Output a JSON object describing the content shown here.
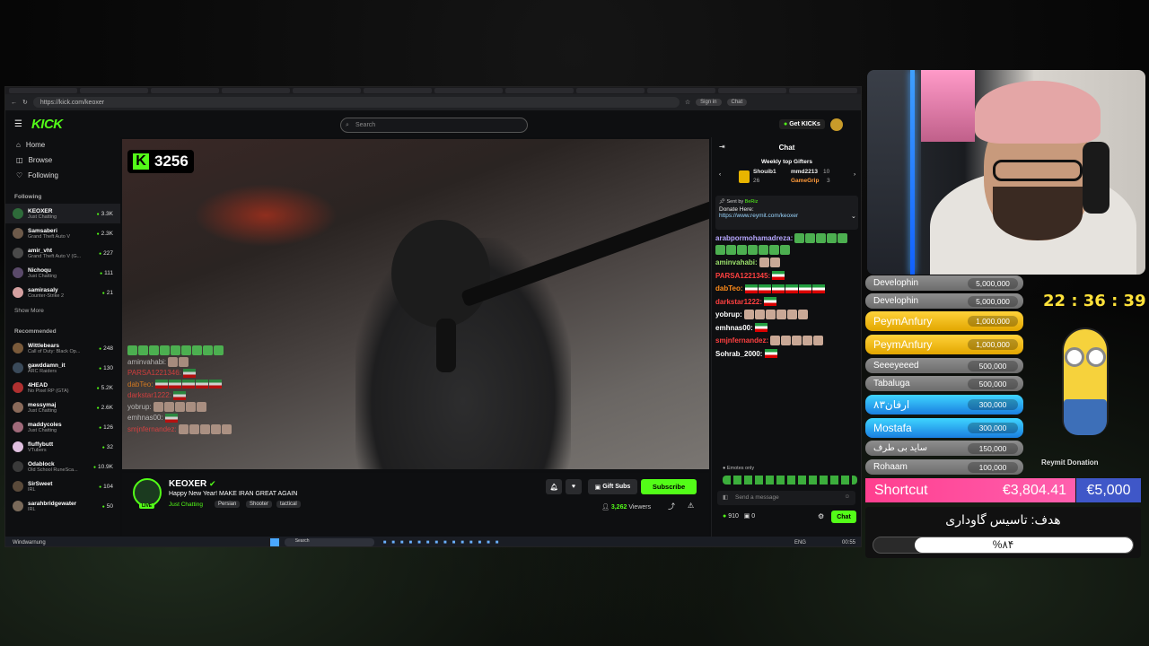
{
  "browser": {
    "url": "https://kick.com/keoxer",
    "signin_label": "Sign in",
    "chat_btn": "Chat"
  },
  "kick": {
    "logo": "KICK",
    "search_placeholder": "Search",
    "get_kicks": "Get KICKs"
  },
  "sidebar": {
    "nav": [
      {
        "label": "Home",
        "icon": "home-icon"
      },
      {
        "label": "Browse",
        "icon": "browse-icon"
      },
      {
        "label": "Following",
        "icon": "heart-icon"
      }
    ],
    "following_title": "Following",
    "following": [
      {
        "name": "KEOXER",
        "category": "Just Chatting",
        "viewers": "3.3K",
        "color": "#2e6b3a"
      },
      {
        "name": "Samsaberi",
        "category": "Grand Theft Auto V",
        "viewers": "2.3K",
        "color": "#6d5a4a"
      },
      {
        "name": "amir_vht",
        "category": "Grand Theft Auto V (G...",
        "viewers": "227",
        "color": "#4a4a4a"
      },
      {
        "name": "Nichoqu",
        "category": "Just Chatting",
        "viewers": "111",
        "color": "#5a4a6a"
      },
      {
        "name": "samirasaly",
        "category": "Counter-Strike 2",
        "viewers": "21",
        "color": "#d4a0a0"
      }
    ],
    "show_more": "Show More",
    "recommended_title": "Recommended",
    "recommended": [
      {
        "name": "Wittlebears",
        "category": "Call of Duty: Black Op...",
        "viewers": "248",
        "color": "#7a5a3a"
      },
      {
        "name": "gawddamn_it",
        "category": "ARC Raiders",
        "viewers": "130",
        "color": "#3a4a5a"
      },
      {
        "name": "4HEAD",
        "category": "No Pixel RP (GTA)",
        "viewers": "5.2K",
        "color": "#b03030"
      },
      {
        "name": "messymaj",
        "category": "Just Chatting",
        "viewers": "2.6K",
        "color": "#8a6a5a"
      },
      {
        "name": "maddycoles",
        "category": "Just Chatting",
        "viewers": "126",
        "color": "#a06a7a"
      },
      {
        "name": "fluffybutt",
        "category": "VTubers",
        "viewers": "32",
        "color": "#e0c0e0"
      },
      {
        "name": "Odablock",
        "category": "Old School RuneSca...",
        "viewers": "10.9K",
        "color": "#3a3a3a"
      },
      {
        "name": "SirSweet",
        "category": "IRL",
        "viewers": "104",
        "color": "#5a4a3a"
      },
      {
        "name": "sarahbridgewater",
        "category": "IRL",
        "viewers": "50",
        "color": "#7a6a5a"
      }
    ]
  },
  "video": {
    "k_count": "3256",
    "overlay_chat": [
      {
        "user": "aminvahabi:",
        "color": "#dddddd",
        "emotes": 2,
        "flags": 0
      },
      {
        "user": "PARSA1221346:",
        "color": "#ff4040",
        "emotes": 0,
        "flags": 1
      },
      {
        "user": "dabTeo:",
        "color": "#ff8c1a",
        "emotes": 0,
        "flags": 5
      },
      {
        "user": "darkstar1222:",
        "color": "#ff4040",
        "emotes": 0,
        "flags": 1
      },
      {
        "user": "yobrup:",
        "color": "#dddddd",
        "emotes": 5,
        "flags": 0
      },
      {
        "user": "emhnas00:",
        "color": "#dddddd",
        "emotes": 0,
        "flags": 1
      },
      {
        "user": "smjnfernandez:",
        "color": "#ff4040",
        "emotes": 5,
        "flags": 0
      }
    ]
  },
  "stream": {
    "name": "KEOXER",
    "title": "Happy New Year! MAKE IRAN GREAT AGAIN",
    "category": "Just Chatting",
    "tags": [
      "Persian",
      "Shooter",
      "tactical"
    ],
    "gift_subs": "Gift Subs",
    "subscribe": "Subscribe",
    "viewers": "3,262",
    "viewers_label": "Viewers",
    "live": "LIVE"
  },
  "chat": {
    "title": "Chat",
    "weekly_gifters": "Weekly top Gifters",
    "gifters": [
      {
        "name": "Shouib1",
        "count": "26"
      },
      {
        "name": "mmd2213",
        "count": "10"
      },
      {
        "name": "GameGrip",
        "count": "3"
      }
    ],
    "pinned_sent_by": "Sent by",
    "pinned_user": "BeRiz",
    "pinned_text": "Donate Here:",
    "pinned_link": "https://www.reymit.com/keoxer",
    "messages": [
      {
        "user": "arabpormohamadreza:",
        "color": "#b7a7ff",
        "emotes": 12,
        "flags": 0,
        "kind": "pepe"
      },
      {
        "user": "aminvahabi:",
        "color": "#9be06b",
        "emotes": 2,
        "flags": 0,
        "kind": "face"
      },
      {
        "user": "PARSA1221345:",
        "color": "#ff4040",
        "emotes": 0,
        "flags": 1,
        "kind": "flag"
      },
      {
        "user": "dabTeo:",
        "color": "#ff8c1a",
        "emotes": 0,
        "flags": 6,
        "kind": "flag"
      },
      {
        "user": "darkstar1222:",
        "color": "#ff4040",
        "emotes": 0,
        "flags": 1,
        "kind": "flag"
      },
      {
        "user": "yobrup:",
        "color": "#ffffff",
        "emotes": 6,
        "flags": 0,
        "kind": "face"
      },
      {
        "user": "emhnas00:",
        "color": "#ffffff",
        "emotes": 0,
        "flags": 1,
        "kind": "flag"
      },
      {
        "user": "smjnfernandez:",
        "color": "#ff4040",
        "emotes": 5,
        "flags": 0,
        "kind": "face"
      },
      {
        "user": "Sohrab_2000:",
        "color": "#ffffff",
        "emotes": 0,
        "flags": 1,
        "kind": "flag"
      }
    ],
    "emotes_only": "Emotes only",
    "input_placeholder": "Send a message",
    "kicks_count": "910",
    "gifts_count": "0",
    "send_label": "Chat"
  },
  "taskbar": {
    "left_label": "Windwarnung",
    "search_placeholder": "Search",
    "lang": "ENG",
    "time": "00:55"
  },
  "overlay": {
    "leaderboard": [
      {
        "name": "Develophin",
        "amount": "5,000,000",
        "style": "gray"
      },
      {
        "name": "Develophin",
        "amount": "5,000,000",
        "style": "gray"
      },
      {
        "name": "PeymAnfury",
        "amount": "1,000,000",
        "style": "gold"
      },
      {
        "name": "PeymAnfury",
        "amount": "1,000,000",
        "style": "gold"
      },
      {
        "name": "Seeeyeeed",
        "amount": "500,000",
        "style": "gray"
      },
      {
        "name": "Tabaluga",
        "amount": "500,000",
        "style": "gray"
      },
      {
        "name": "ارفان۸۳",
        "amount": "300,000",
        "style": "blue"
      },
      {
        "name": "Mostafa",
        "amount": "300,000",
        "style": "blue"
      },
      {
        "name": "ساید بی طرف",
        "amount": "150,000",
        "style": "gray"
      },
      {
        "name": "Rohaam",
        "amount": "100,000",
        "style": "gray"
      }
    ],
    "timer": "22 : 36 : 39",
    "reymit_label": "Reymit Donation",
    "shortcut_label": "Shortcut",
    "raised": "€3,804.41",
    "goal": "€5,000",
    "goal_title": "هدف: تاسیس گاوداری",
    "goal_percent_text": "%۸۴",
    "goal_progress": 0.84
  }
}
